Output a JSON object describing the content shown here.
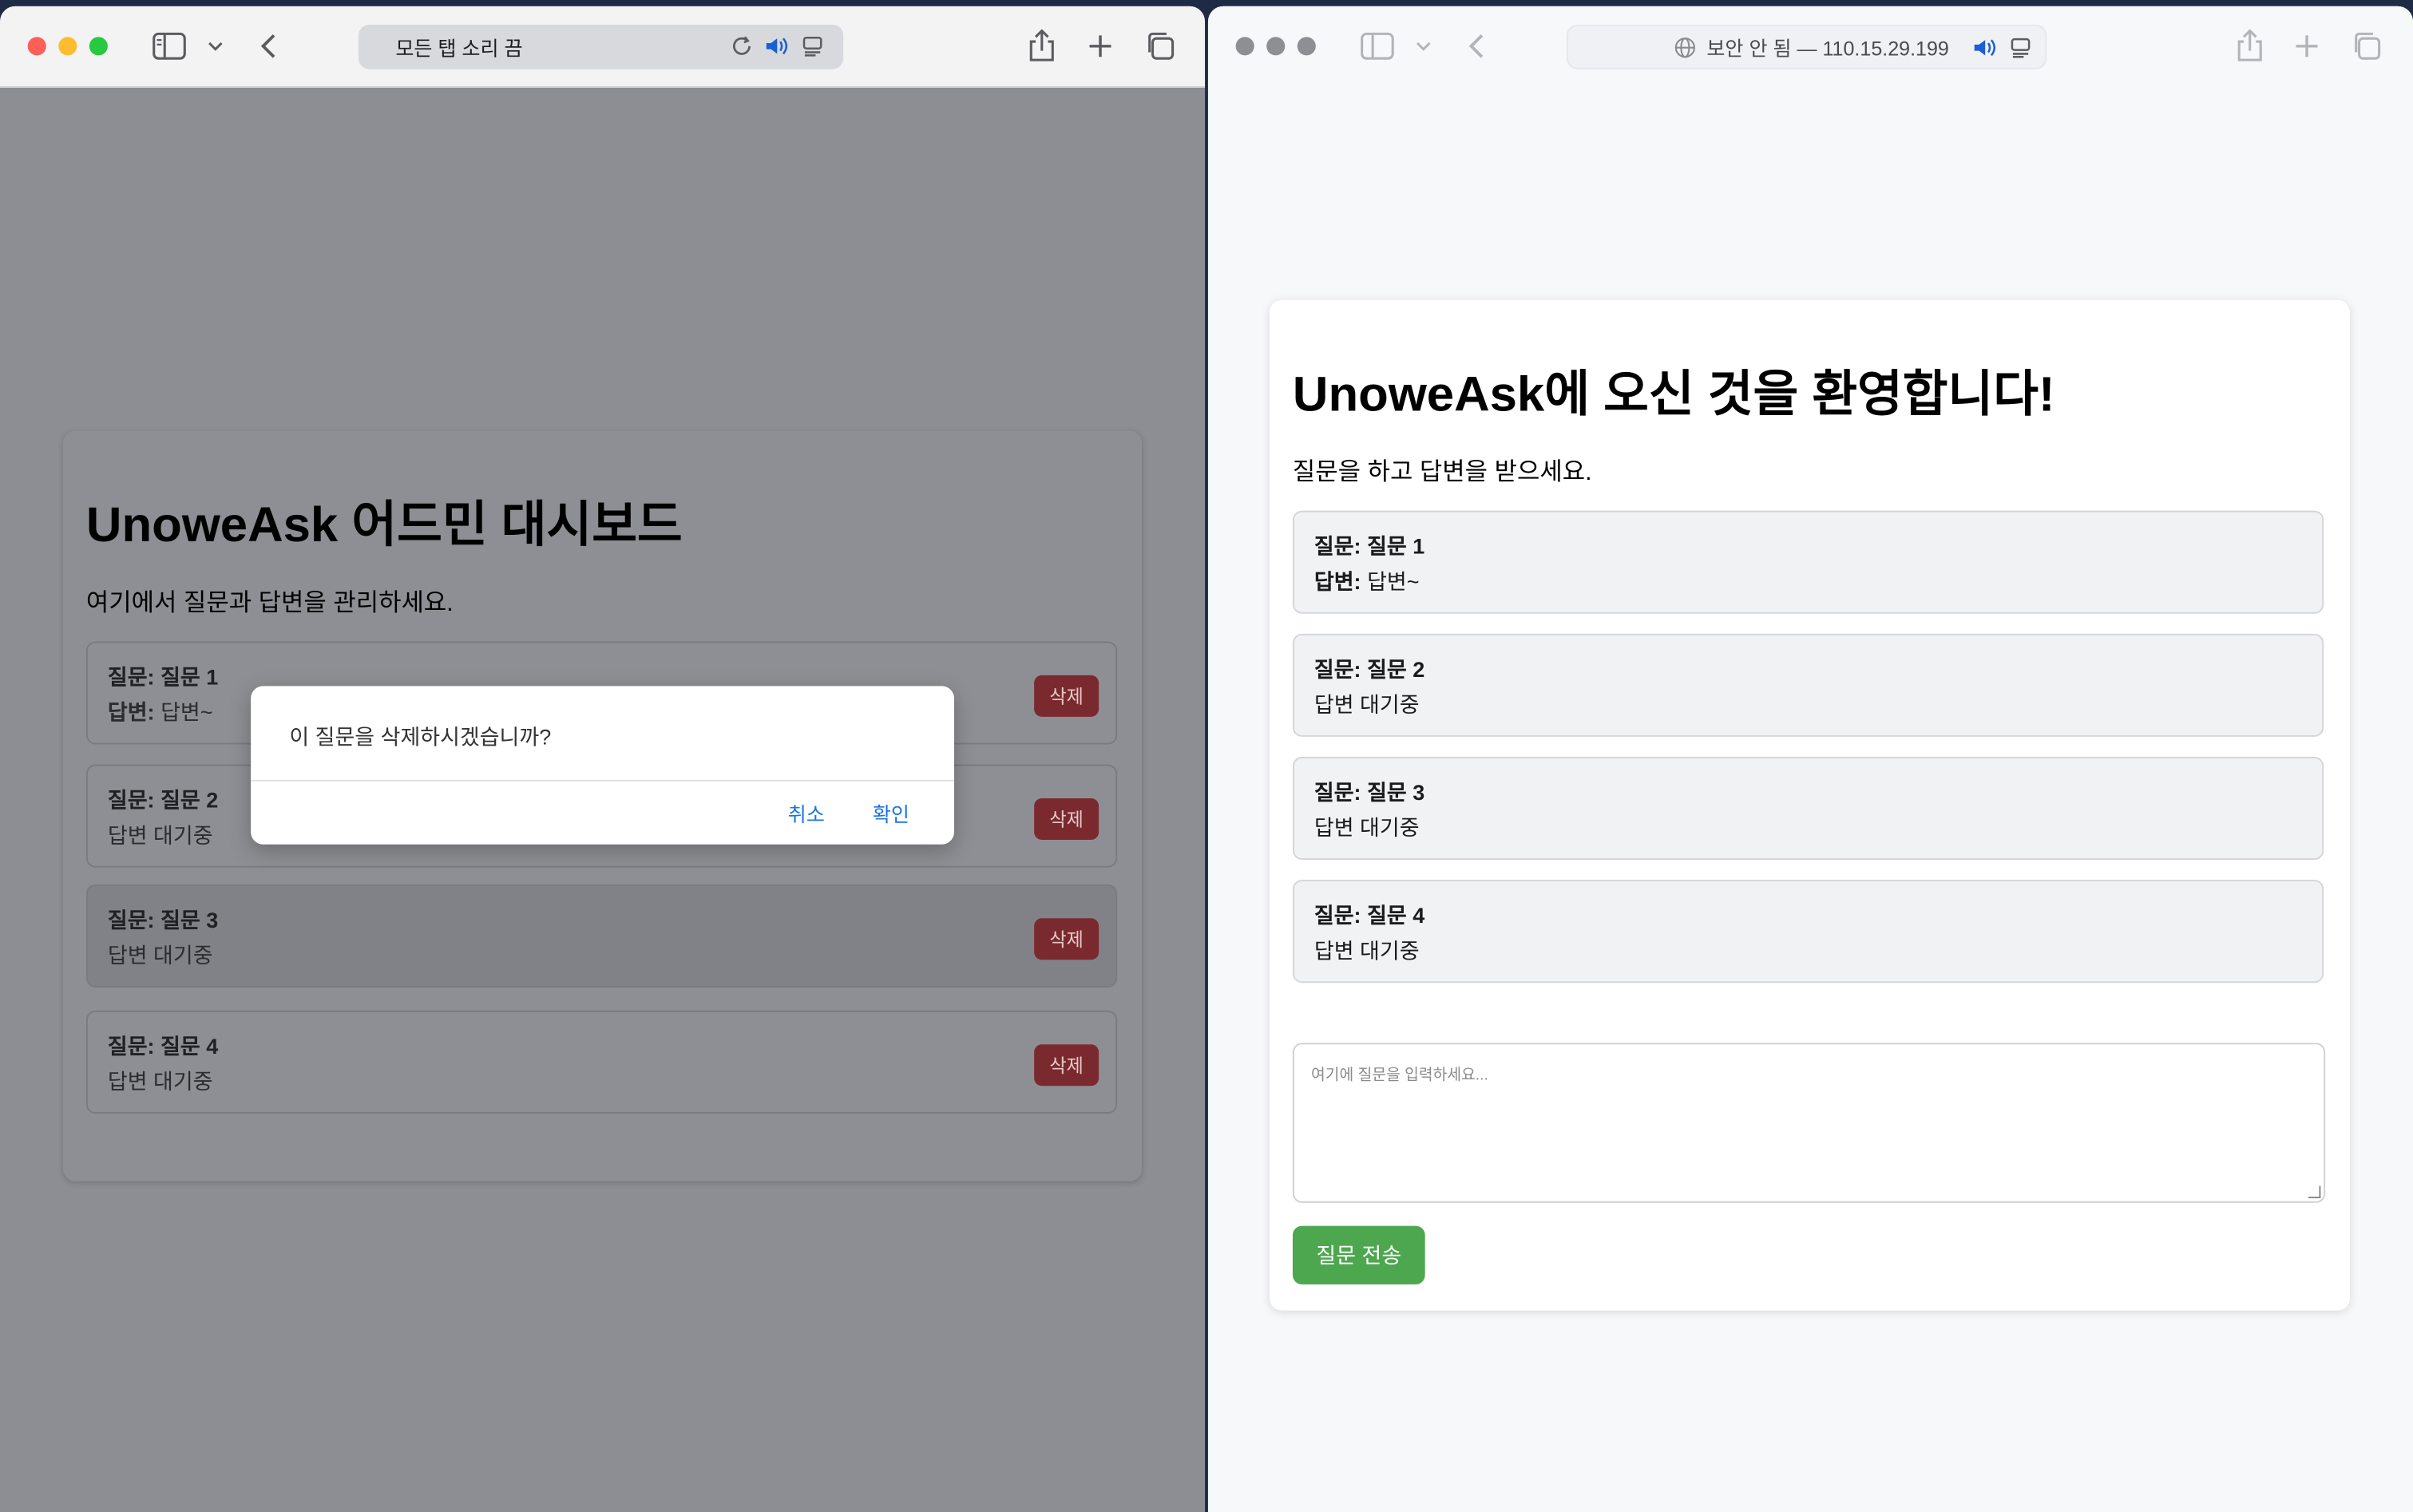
{
  "left_window": {
    "address_text": "모든 탭 소리 끔",
    "page": {
      "title": "UnoweAsk 어드민 대시보드",
      "subtitle": "여기에서 질문과 답변을 관리하세요.",
      "items": [
        {
          "question_label": "질문:",
          "question": "질문 1",
          "answer_label": "답변:",
          "answer": "답변~",
          "delete": "삭제"
        },
        {
          "question_label": "질문:",
          "question": "질문 2",
          "answer": "답변 대기중",
          "delete": "삭제"
        },
        {
          "question_label": "질문:",
          "question": "질문 3",
          "answer": "답변 대기중",
          "delete": "삭제"
        },
        {
          "question_label": "질문:",
          "question": "질문 4",
          "answer": "답변 대기중",
          "delete": "삭제"
        }
      ]
    },
    "dialog": {
      "message": "이 질문을 삭제하시겠습니까?",
      "cancel": "취소",
      "confirm": "확인"
    }
  },
  "right_window": {
    "address_text": "보안 안 됨 — 110.15.29.199",
    "page": {
      "title": "UnoweAsk에 오신 것을 환영합니다!",
      "subtitle": "질문을 하고 답변을 받으세요.",
      "items": [
        {
          "question_label": "질문:",
          "question": "질문 1",
          "answer_label": "답변:",
          "answer": "답변~"
        },
        {
          "question_label": "질문:",
          "question": "질문 2",
          "answer": "답변 대기중"
        },
        {
          "question_label": "질문:",
          "question": "질문 3",
          "answer": "답변 대기중"
        },
        {
          "question_label": "질문:",
          "question": "질문 4",
          "answer": "답변 대기중"
        }
      ],
      "textarea_placeholder": "여기에 질문을 입력하세요...",
      "submit": "질문 전송"
    }
  },
  "colors": {
    "delete_button": "#7a2a2e",
    "submit_button": "#4da74f",
    "dialog_link": "#1a73e8",
    "audio_icon": "#1a5fd6"
  }
}
